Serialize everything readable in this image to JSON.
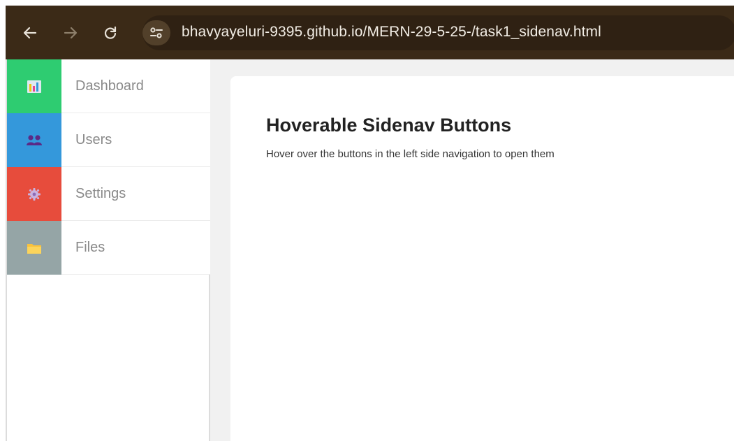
{
  "browser": {
    "url": "bhavyayeluri-9395.github.io/MERN-29-5-25-/task1_sidenav.html",
    "back_icon": "arrow-left-icon",
    "forward_icon": "arrow-right-icon",
    "reload_icon": "reload-icon",
    "site_info_icon": "tune-icon"
  },
  "sidebar": {
    "items": [
      {
        "label": "Dashboard",
        "icon": "bar-chart-icon",
        "color": "#2ecc71"
      },
      {
        "label": "Users",
        "icon": "users-icon",
        "color": "#3498db"
      },
      {
        "label": "Settings",
        "icon": "gear-icon",
        "color": "#e74c3c"
      },
      {
        "label": "Files",
        "icon": "folder-icon",
        "color": "#95a5a6"
      }
    ]
  },
  "main": {
    "title": "Hoverable Sidenav Buttons",
    "description": "Hover over the buttons in the left side navigation to open them"
  }
}
